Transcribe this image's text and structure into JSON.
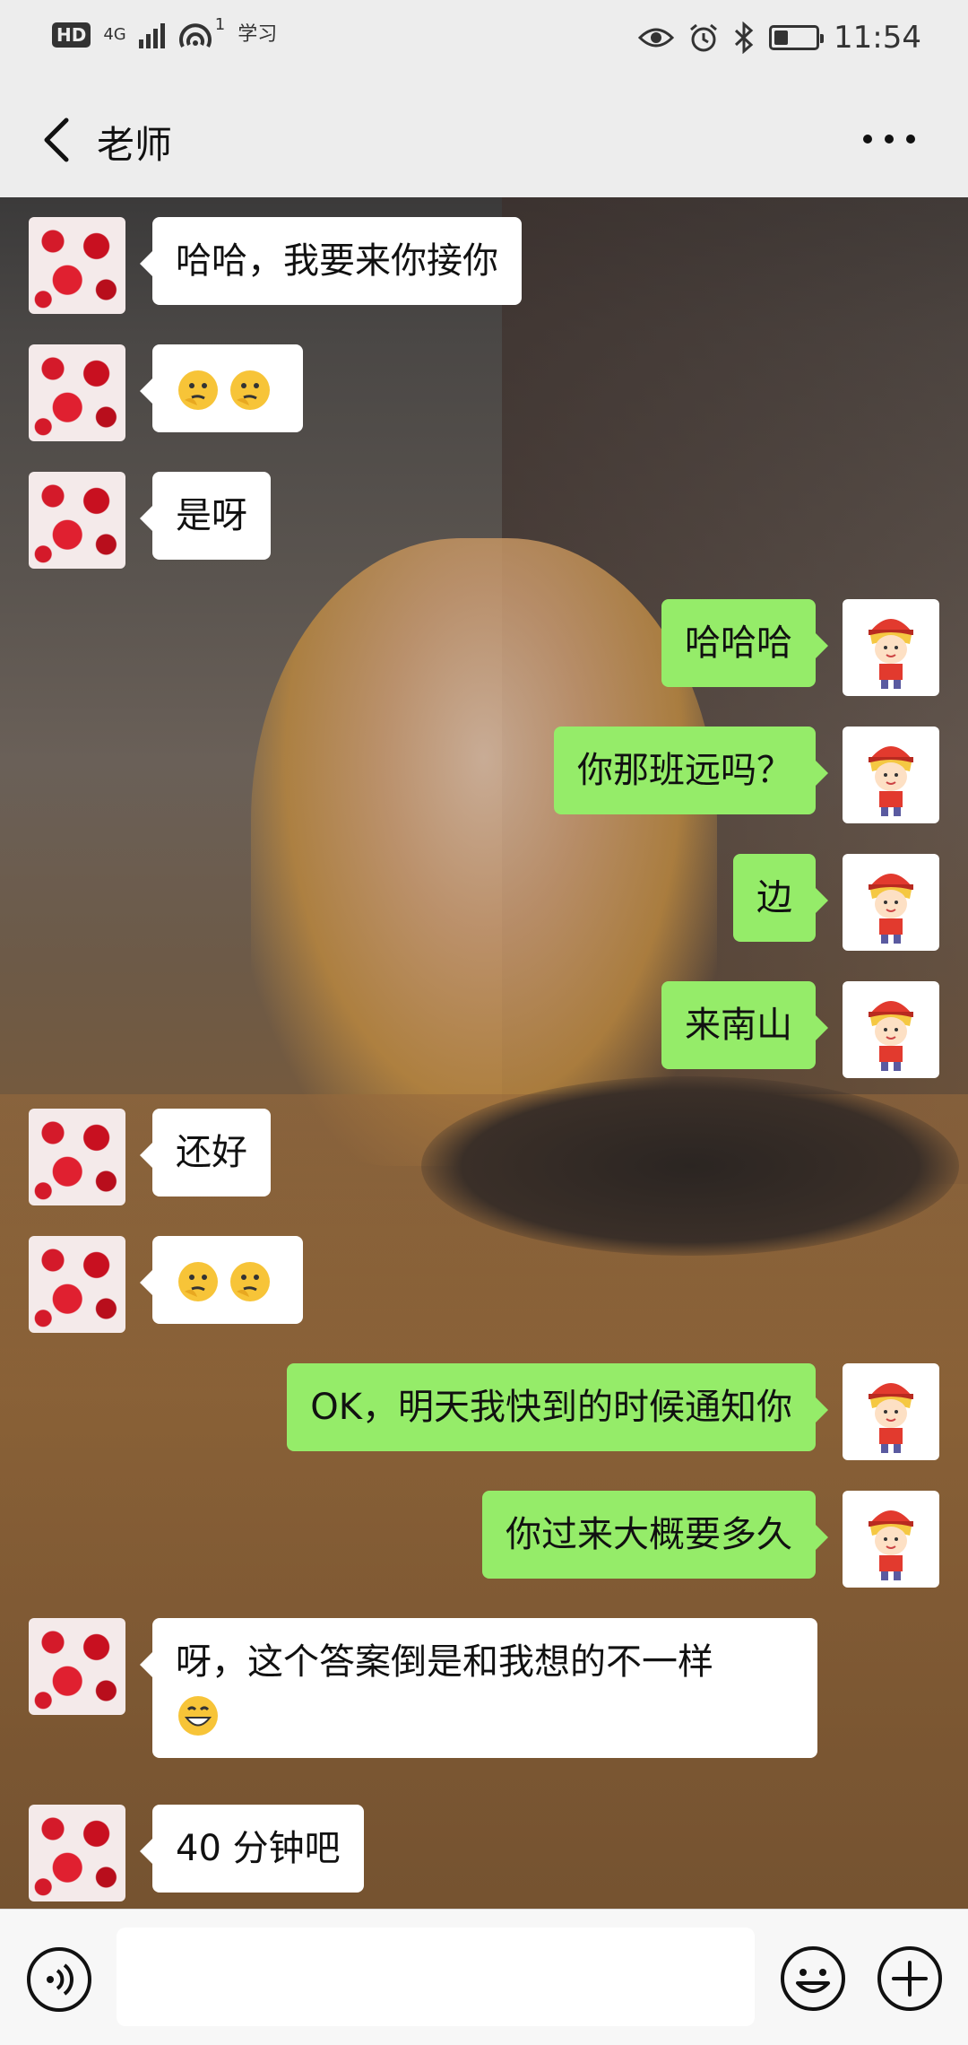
{
  "status_bar": {
    "hd": "HD",
    "network": "4G",
    "hotspot_count": "1",
    "app_hint": "学习",
    "time": "11:54",
    "battery_percent": 35
  },
  "header": {
    "title": "老师"
  },
  "messages": [
    {
      "side": "left",
      "text": "哈哈，我要来你接你"
    },
    {
      "side": "left",
      "emoji": [
        "thinking-face",
        "thinking-face"
      ]
    },
    {
      "side": "left",
      "text": "是呀"
    },
    {
      "side": "right",
      "text": "哈哈哈"
    },
    {
      "side": "right",
      "text": "你那班远吗？"
    },
    {
      "side": "right",
      "text": "边"
    },
    {
      "side": "right",
      "text": "来南山"
    },
    {
      "side": "left",
      "text": "还好"
    },
    {
      "side": "left",
      "emoji": [
        "thinking-face",
        "thinking-face"
      ]
    },
    {
      "side": "right",
      "text": "OK，明天我快到的时候通知你"
    },
    {
      "side": "right",
      "text": "你过来大概要多久"
    },
    {
      "side": "left",
      "text": "呀，这个答案倒是和我想的不一样",
      "trailing_emoji": "grinning-face"
    },
    {
      "side": "left",
      "text": "40 分钟吧"
    }
  ],
  "input": {
    "value": "",
    "placeholder": ""
  },
  "icons": {
    "back": "back-arrow-icon",
    "more": "more-dots-icon",
    "voice": "voice-icon",
    "emoji": "emoji-icon",
    "plus": "plus-icon"
  },
  "colors": {
    "sent_bubble": "#95ec69",
    "received_bubble": "#ffffff",
    "bar_bg": "#ededed"
  }
}
